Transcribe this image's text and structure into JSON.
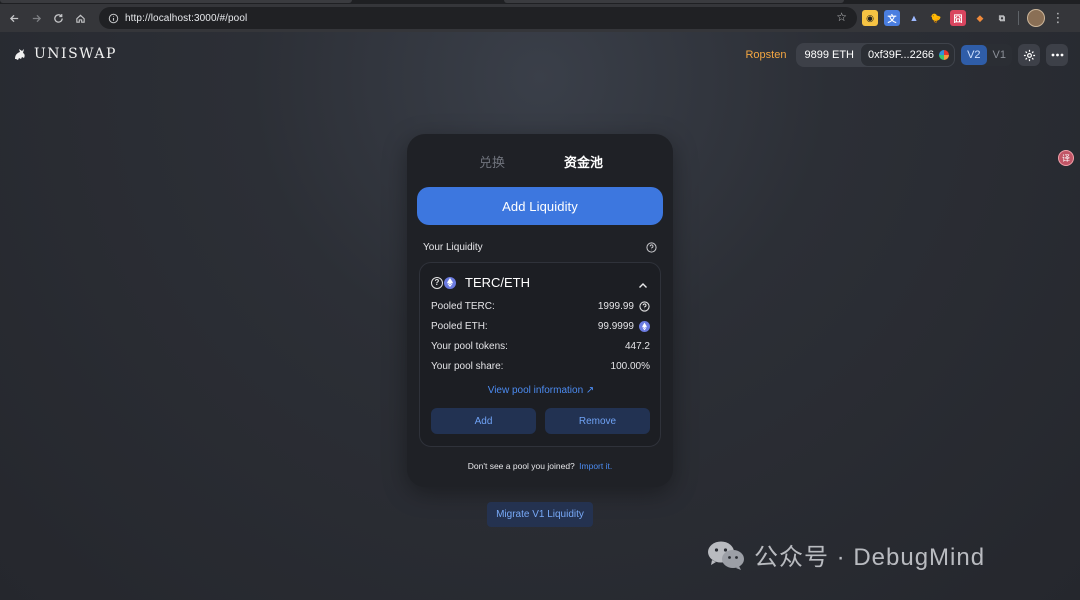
{
  "browser": {
    "url": "http://localhost:3000/#/pool",
    "extensions": [
      "yellow-badge-icon",
      "translate-icon",
      "triangle-icon",
      "duck-icon",
      "red-sheet-icon",
      "fox-icon",
      "puzzle-icon"
    ]
  },
  "header": {
    "brand": "UNISWAP",
    "network": "Ropsten",
    "balance": "9899 ETH",
    "address": "0xf39F...2266",
    "version_active": "V2",
    "version_inactive": "V1"
  },
  "card": {
    "tabs": {
      "swap": "兑换",
      "pool": "资金池"
    },
    "add_liquidity": "Add Liquidity",
    "your_liquidity": "Your Liquidity",
    "position": {
      "pair": "TERC/ETH",
      "rows": [
        {
          "label": "Pooled TERC:",
          "value": "1999.99",
          "icon": "question-token-icon"
        },
        {
          "label": "Pooled ETH:",
          "value": "99.9999",
          "icon": "eth-token-icon"
        },
        {
          "label": "Your pool tokens:",
          "value": "447.2"
        },
        {
          "label": "Your pool share:",
          "value": "100.00%"
        }
      ],
      "view_pool": "View pool information ↗",
      "add": "Add",
      "remove": "Remove"
    },
    "footnote": "Don't see a pool you joined?",
    "import_link": "Import it."
  },
  "migrate": "Migrate V1 Liquidity",
  "watermark": "公众号 · DebugMind",
  "colors": {
    "accent": "#3d77df",
    "network": "#f3a642",
    "link": "#4c8bf0",
    "card_bg": "#1f2126"
  }
}
